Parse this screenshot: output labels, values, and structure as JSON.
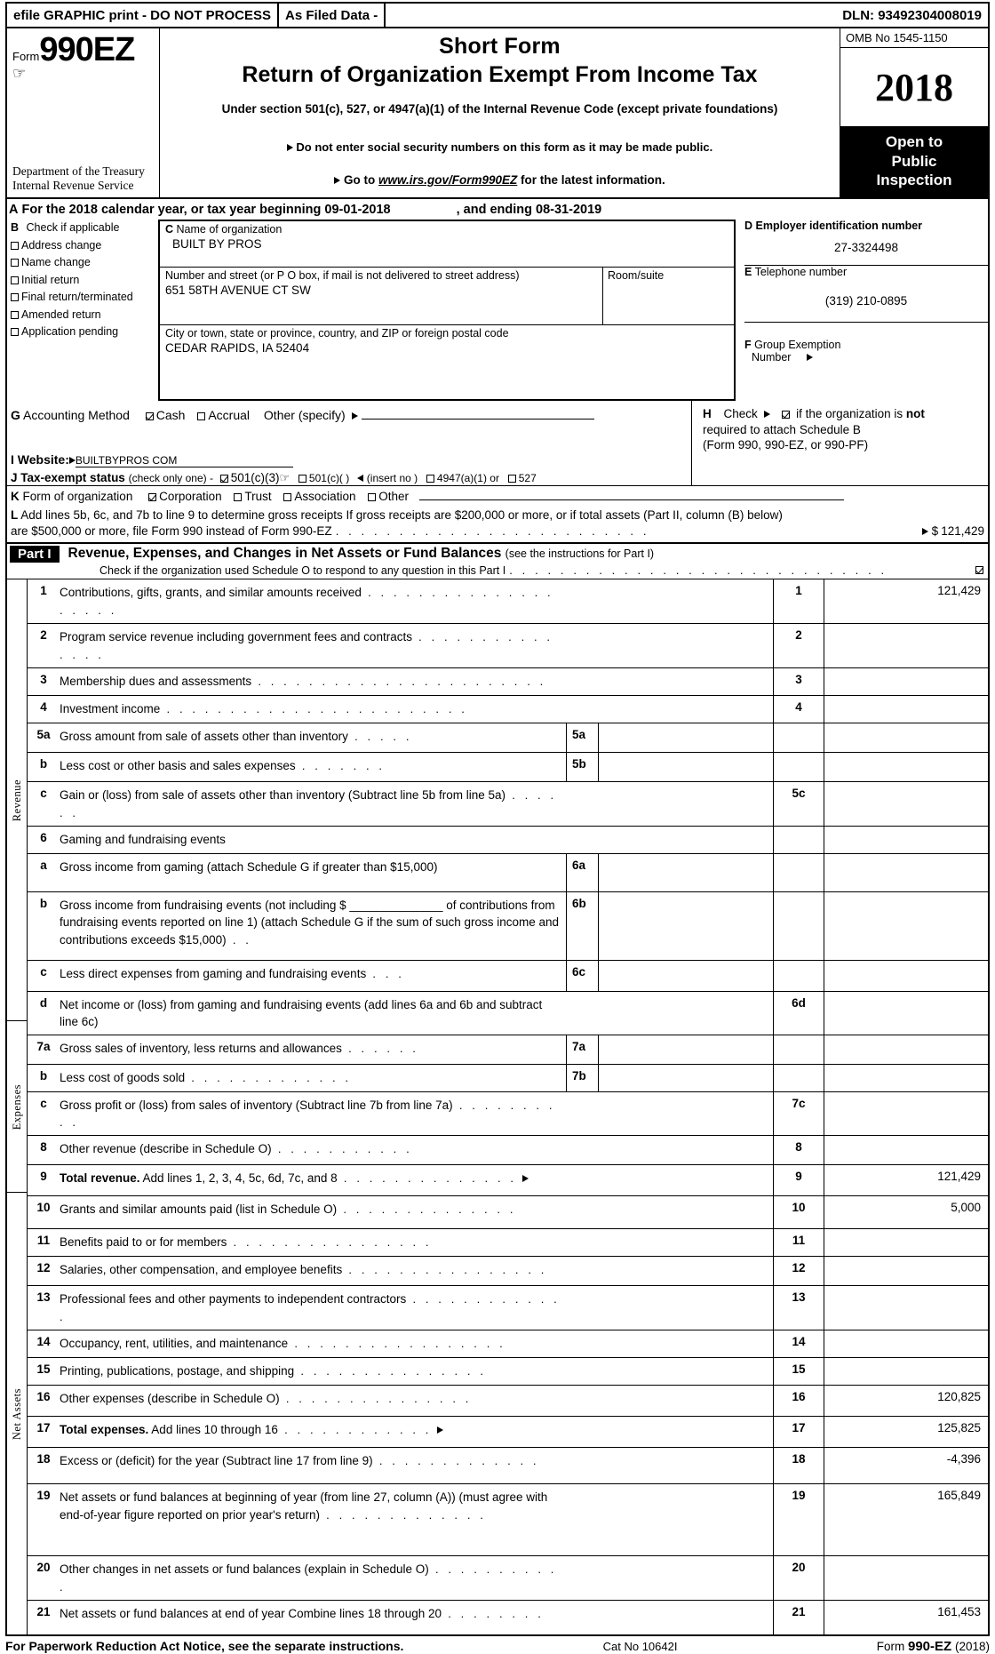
{
  "efile_bar": {
    "left": "efile GRAPHIC print - DO NOT PROCESS",
    "middle": "As Filed Data -",
    "dln": "DLN: 93492304008019"
  },
  "masthead": {
    "form_label": "Form",
    "form_number": "990EZ",
    "department": "Department of the Treasury",
    "agency": "Internal Revenue Service",
    "title_line1": "Short Form",
    "title_line2": "Return of Organization Exempt From Income Tax",
    "subtitle": "Under section 501(c), 527, or 4947(a)(1) of the Internal Revenue Code (except private foundations)",
    "notice1": "Do not enter social security numbers on this form as it may be made public.",
    "notice2_prefix": "Go to",
    "notice2_url": "www.irs.gov/Form990EZ",
    "notice2_suffix": "for the latest information.",
    "omb": "OMB No  1545-1150",
    "tax_year": "2018",
    "open_to_public": [
      "Open to",
      "Public",
      "Inspection"
    ]
  },
  "section_a": {
    "letter": "A",
    "text_before": "For the 2018 calendar year, or tax year beginning",
    "begin_date": "09-01-2018",
    "text_middle": ", and ending",
    "end_date": "08-31-2019"
  },
  "section_b": {
    "letter": "B",
    "heading": "Check if applicable",
    "options": [
      {
        "label": "Address change",
        "checked": false
      },
      {
        "label": "Name change",
        "checked": false
      },
      {
        "label": "Initial return",
        "checked": false
      },
      {
        "label": "Final return/terminated",
        "checked": false
      },
      {
        "label": "Amended return",
        "checked": false
      },
      {
        "label": "Application pending",
        "checked": false
      }
    ]
  },
  "section_c": {
    "letter": "C",
    "name_label": "Name of organization",
    "name_value": "BUILT BY PROS",
    "street_label": "Number and street (or P  O  box, if mail is not delivered to street address)",
    "street_value": "651 58TH AVENUE CT SW",
    "room_label": "Room/suite",
    "room_value": "",
    "city_label": "City or town, state or province, country, and ZIP or foreign postal code",
    "city_value": "CEDAR RAPIDS, IA  52404"
  },
  "section_d": {
    "letter": "D",
    "label": "Employer identification number",
    "value": "27-3324498"
  },
  "section_e": {
    "letter": "E",
    "label": "Telephone number",
    "value": "(319) 210-0895"
  },
  "section_f": {
    "letter": "F",
    "label_line1": "Group Exemption",
    "label_line2": "Number",
    "value": ""
  },
  "section_g": {
    "letter": "G",
    "label": "Accounting Method",
    "cash": {
      "label": "Cash",
      "checked": true
    },
    "accrual": {
      "label": "Accrual",
      "checked": false
    },
    "other_label": "Other (specify)",
    "other_value": ""
  },
  "section_h": {
    "letter": "H",
    "check_label": "Check",
    "checked": true,
    "line1_a": "if the organization is",
    "line1_b": "not",
    "line2": "required to attach Schedule B",
    "line3": "(Form 990, 990-EZ, or 990-PF)"
  },
  "section_i": {
    "letter": "I",
    "label": "Website:",
    "value": "BUILTBYPROS COM"
  },
  "section_j": {
    "letter": "J",
    "label": "Tax-exempt status",
    "note": "(check only one) -",
    "options": [
      {
        "label": "501(c)(3)",
        "checked": true
      },
      {
        "label": "501(c)(  )",
        "checked": false
      },
      {
        "label": "4947(a)(1) or",
        "checked": false
      },
      {
        "label": "527",
        "checked": false
      }
    ],
    "insert_note": "(insert no )"
  },
  "section_k": {
    "letter": "K",
    "label": "Form of organization",
    "options": [
      {
        "label": "Corporation",
        "checked": true
      },
      {
        "label": "Trust",
        "checked": false
      },
      {
        "label": "Association",
        "checked": false
      },
      {
        "label": "Other",
        "checked": false
      }
    ]
  },
  "section_l": {
    "letter": "L",
    "line1": "Add lines 5b, 6c, and 7b to line 9 to determine gross receipts  If gross receipts are $200,000 or more, or if total assets (Part II, column (B) below)",
    "line2": "are $500,000 or more, file Form 990 instead of Form 990-EZ",
    "amount_prefix": "$",
    "amount": "121,429"
  },
  "part1": {
    "label": "Part I",
    "title": "Revenue, Expenses, and Changes in Net Assets or Fund Balances",
    "title_note": "(see the instructions for Part I)",
    "schedule_o_text": "Check if the organization used Schedule O to respond to any question in this Part I",
    "schedule_o_checked": true
  },
  "sidebar_labels": {
    "revenue": "Revenue",
    "expenses": "Expenses",
    "net_assets": "Net Assets"
  },
  "table_rows": [
    {
      "num": "1",
      "desc": "Contributions, gifts, grants, and similar amounts received",
      "dots": 20,
      "sub_num": "",
      "colA": "1",
      "colB": "121,429"
    },
    {
      "num": "2",
      "desc": "Program service revenue including government fees and contracts",
      "dots": 15,
      "sub_num": "",
      "colA": "2",
      "colB": ""
    },
    {
      "num": "3",
      "desc": "Membership dues and assessments",
      "dots": 23,
      "sub_num": "",
      "colA": "3",
      "colB": ""
    },
    {
      "num": "4",
      "desc": "Investment income",
      "dots": 24,
      "sub_num": "",
      "colA": "4",
      "colB": ""
    },
    {
      "num": "5a",
      "desc": "Gross amount from sale of assets other than inventory",
      "dots": 5,
      "sub_num": "5a",
      "colA": "",
      "colB": ""
    },
    {
      "num": "b",
      "desc": "Less  cost or other basis and sales expenses",
      "dots": 7,
      "sub_num": "5b",
      "colA": "",
      "colB": ""
    },
    {
      "num": "c",
      "desc": "Gain or (loss) from sale of assets other than inventory (Subtract line 5b from line 5a)",
      "dots": 6,
      "sub_num": "",
      "colA": "5c",
      "colB": ""
    },
    {
      "num": "6",
      "desc": "Gaming and fundraising events",
      "dots": 0,
      "sub_num": "",
      "colA": "",
      "colB": ""
    },
    {
      "num": "a",
      "desc": "Gross income from gaming (attach Schedule G if greater than $15,000)",
      "dots": 0,
      "sub_num": "6a",
      "colA": "",
      "colB": ""
    },
    {
      "num": "b",
      "desc": "Gross income from fundraising events (not including $ ______________ of contributions from fundraising events reported on line 1) (attach Schedule G if the sum of such gross income and contributions exceeds $15,000)",
      "dots": 2,
      "sub_num": "6b",
      "colA": "",
      "colB": ""
    },
    {
      "num": "c",
      "desc": "Less  direct expenses from gaming and fundraising events",
      "dots": 3,
      "sub_num": "6c",
      "colA": "",
      "colB": ""
    },
    {
      "num": "d",
      "desc": "Net income or (loss) from gaming and fundraising events (add lines 6a and 6b and subtract line 6c)",
      "dots": 0,
      "sub_num": "",
      "colA": "6d",
      "colB": ""
    },
    {
      "num": "7a",
      "desc": "Gross sales of inventory, less returns and allowances",
      "dots": 6,
      "sub_num": "7a",
      "colA": "",
      "colB": ""
    },
    {
      "num": "b",
      "desc": "Less  cost of goods sold",
      "dots": 13,
      "sub_num": "7b",
      "colA": "",
      "colB": ""
    },
    {
      "num": "c",
      "desc": "Gross profit or (loss) from sales of inventory (Subtract line 7b from line 7a)",
      "dots": 10,
      "sub_num": "",
      "colA": "7c",
      "colB": ""
    },
    {
      "num": "8",
      "desc": "Other revenue (describe in Schedule O)",
      "dots": 11,
      "sub_num": "",
      "colA": "8",
      "colB": ""
    },
    {
      "num": "9",
      "desc": "Total revenue. Add lines 1, 2, 3, 4, 5c, 6d, 7c, and 8",
      "dots": 14,
      "bold_prefix": "Total revenue.",
      "arrow": true,
      "sub_num": "",
      "colA": "9",
      "colB": "121,429"
    },
    {
      "num": "10",
      "desc": "Grants and similar amounts paid (list in Schedule O)",
      "dots": 14,
      "sub_num": "",
      "colA": "10",
      "colB": "5,000"
    },
    {
      "num": "11",
      "desc": "Benefits paid to or for members",
      "dots": 16,
      "sub_num": "",
      "colA": "11",
      "colB": ""
    },
    {
      "num": "12",
      "desc": "Salaries, other compensation, and employee benefits",
      "dots": 16,
      "sub_num": "",
      "colA": "12",
      "colB": ""
    },
    {
      "num": "13",
      "desc": "Professional fees and other payments to independent contractors",
      "dots": 13,
      "sub_num": "",
      "colA": "13",
      "colB": ""
    },
    {
      "num": "14",
      "desc": "Occupancy, rent, utilities, and maintenance",
      "dots": 17,
      "sub_num": "",
      "colA": "14",
      "colB": ""
    },
    {
      "num": "15",
      "desc": "Printing, publications, postage, and shipping",
      "dots": 15,
      "sub_num": "",
      "colA": "15",
      "colB": ""
    },
    {
      "num": "16",
      "desc": "Other expenses (describe in Schedule O)",
      "dots": 15,
      "sub_num": "",
      "colA": "16",
      "colB": "120,825"
    },
    {
      "num": "17",
      "desc": "Total expenses. Add lines 10 through 16",
      "dots": 12,
      "bold_prefix": "Total expenses.",
      "arrow": true,
      "sub_num": "",
      "colA": "17",
      "colB": "125,825"
    },
    {
      "num": "18",
      "desc": "Excess or (deficit) for the year (Subtract line 17 from line 9)",
      "dots": 13,
      "sub_num": "",
      "colA": "18",
      "colB": "-4,396"
    },
    {
      "num": "19",
      "desc": "Net assets or fund balances at beginning of year (from line 27, column (A)) (must agree with end-of-year figure reported on prior year's return)",
      "dots": 13,
      "sub_num": "",
      "colA": "19",
      "colB": "165,849"
    },
    {
      "num": "20",
      "desc": "Other changes in net assets or fund balances (explain in Schedule O)",
      "dots": 11,
      "sub_num": "",
      "colA": "20",
      "colB": ""
    },
    {
      "num": "21",
      "desc": "Net assets or fund balances at end of year  Combine lines 18 through 20",
      "dots": 8,
      "sub_num": "",
      "colA": "21",
      "colB": "161,453"
    }
  ],
  "footer": {
    "left": "For Paperwork Reduction Act Notice, see the separate instructions.",
    "center": "Cat  No  10642I",
    "right_prefix": "Form",
    "right_bold": "990-EZ",
    "right_suffix": "(2018)"
  }
}
